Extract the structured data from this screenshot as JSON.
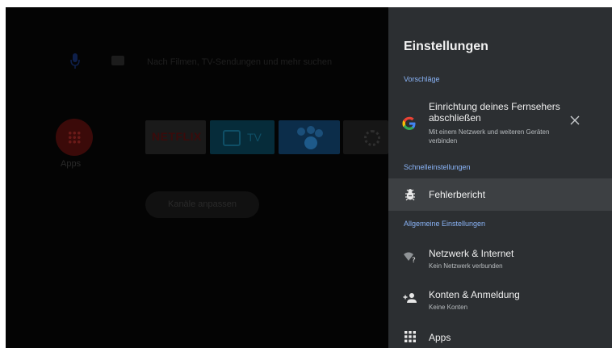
{
  "home": {
    "search_placeholder": "Nach Filmen, TV-Sendungen und mehr suchen",
    "apps_label": "Apps",
    "tiles": {
      "netflix": "NETFLIX",
      "tv": "TV"
    },
    "channels_button": "Kanäle anpassen"
  },
  "settings": {
    "title": "Einstellungen",
    "sections": {
      "suggestions": "Vorschläge",
      "quick": "Schnelleinstellungen",
      "general": "Allgemeine Einstellungen"
    },
    "suggestion": {
      "title_line1": "Einrichtung deines Fernsehers",
      "title_line2": "abschließen",
      "sub_line1": "Mit einem Netzwerk und weiteren Geräten",
      "sub_line2": "verbinden",
      "icon_letter": "G"
    },
    "items": {
      "bugreport": "Fehlerbericht",
      "network": {
        "label": "Netzwerk & Internet",
        "sub": "Kein Netzwerk verbunden"
      },
      "accounts": {
        "label": "Konten & Anmeldung",
        "sub": "Keine Konten"
      },
      "apps": "Apps"
    }
  },
  "colors": {
    "accent": "#8ab4f8",
    "panel": "#2c2f32",
    "highlight": "#3d4043"
  }
}
